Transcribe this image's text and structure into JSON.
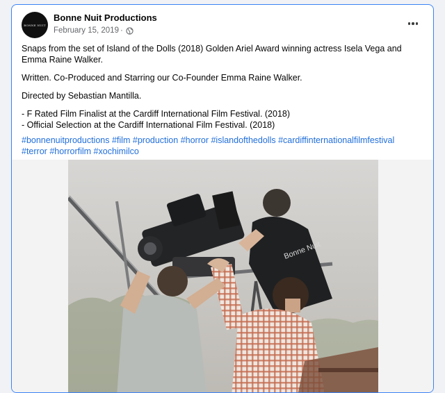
{
  "post": {
    "page_name": "Bonne Nuit Productions",
    "avatar_text": "BONNE NUIT",
    "date": "February 15, 2019",
    "separator": "·",
    "privacy_icon": "globe-icon",
    "more_icon": "more-options-icon",
    "paragraphs": [
      "Snaps from the set of Island of the Dolls (2018) Golden Ariel Award winning actress Isela Vega and Emma Raine Walker.",
      "Written. Co-Produced and Starring our Co-Founder Emma Raine Walker.",
      "Directed by Sebastian Mantilla."
    ],
    "list_items": [
      "- F Rated Film Finalist at the Cardiff International Film Festival. (2018)",
      "- Official Selection at the Cardiff International Film Festival. (2018)"
    ],
    "hashtags": [
      "#bonnenuitproductions",
      "#film",
      "#production",
      "#horror",
      "#islandofthedolls",
      "#cardiffinternationalfilmfestival",
      "#terror",
      "#horrorfilm",
      "#xochimilco"
    ],
    "photo_shirt_text": "Bonne Nuit"
  },
  "colors": {
    "link": "#216fdb",
    "secondary_text": "#65676b",
    "focus_border": "#3b82f6"
  }
}
